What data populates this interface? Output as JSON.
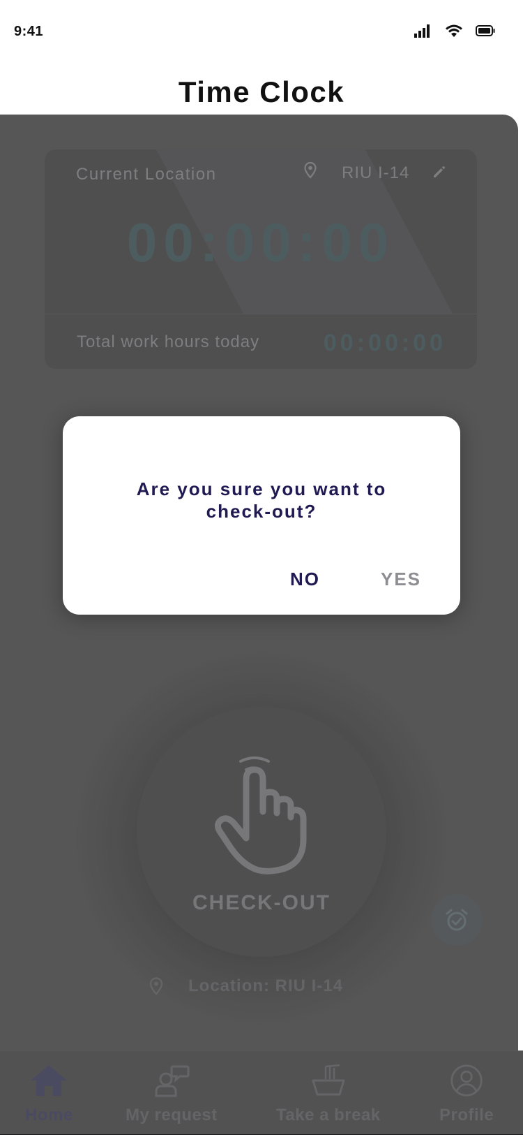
{
  "status_bar": {
    "time": "9:41"
  },
  "page": {
    "title": "Time Clock"
  },
  "timer_card": {
    "location_label": "Current Location",
    "location_name": "RIU I-14",
    "elapsed_time": "00:00:00",
    "total_label": "Total work hours today",
    "total_time": "00:00:00"
  },
  "checkout": {
    "label": "CHECK-OUT"
  },
  "bottom_location": {
    "text": "Location: RIU I-14"
  },
  "dialog": {
    "message_line1": "Are you sure you want to",
    "message_line2": "check-out?",
    "no_label": "NO",
    "yes_label": "YES"
  },
  "nav": {
    "items": [
      {
        "label": "Home",
        "icon": "home-icon",
        "active": true
      },
      {
        "label": "My request",
        "icon": "request-icon",
        "active": false
      },
      {
        "label": "Take a break",
        "icon": "break-icon",
        "active": false
      },
      {
        "label": "Profile",
        "icon": "profile-icon",
        "active": false
      }
    ]
  },
  "colors": {
    "dialog_text": "#201a52",
    "dialog_yes": "#8d8d93",
    "timer_digits": "#102528",
    "panel_bg": "#1c1c1c"
  }
}
